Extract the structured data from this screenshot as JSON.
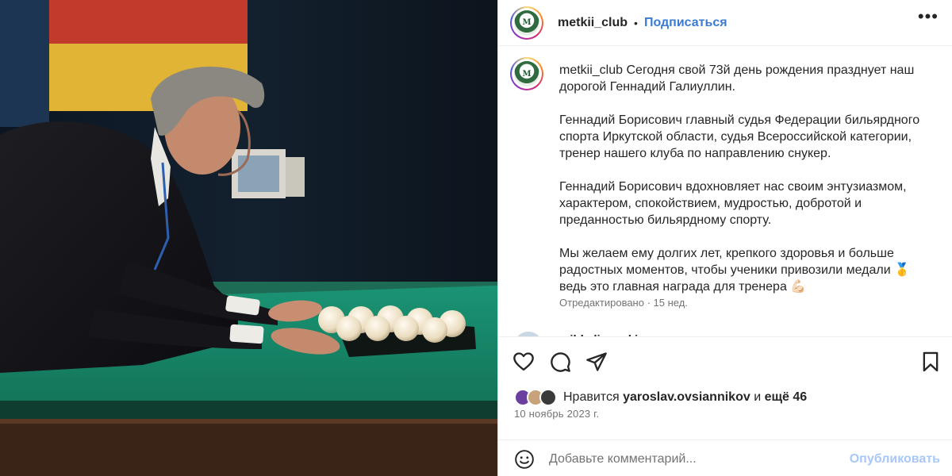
{
  "account": {
    "username": "metkii_club",
    "avatar_initials": "M",
    "follow_label": "Подписаться",
    "dot": "•",
    "more_label": "•••"
  },
  "caption": {
    "username": "metkii_club",
    "paragraphs": [
      "Сегодня свой 73й день рождения празднует наш дорогой Геннадий Галиуллин.",
      "Геннадий Борисович главный судья Федерации бильярдного спорта Иркутской области, судья Всероссийской категории, тренер нашего клуба по направлению снукер.",
      "Геннадий Борисович вдохновляет нас своим энтузиазмом, характером, спокойствием, мудростью, добротой и преданностью бильярдному спорту.",
      "Мы желаем ему долгих лет, крепкого здоровья и больше радостных моментов, чтобы ученики привозили медали 🥇 ведь это главная награда для тренера 💪🏻"
    ],
    "meta": "Отредактировано · 15 нед."
  },
  "comment_peek": {
    "text": "mihkalinovski"
  },
  "actions": {
    "like_icon": "heart-icon",
    "comment_icon": "comment-icon",
    "share_icon": "share-icon",
    "save_icon": "bookmark-icon"
  },
  "likes": {
    "prefix": "Нравится",
    "user": "yaroslav.ovsiannikov",
    "connector": "и",
    "others": "ещё 46"
  },
  "date": "10 ноябрь 2023 г.",
  "comment_box": {
    "placeholder": "Добавьте комментарий...",
    "publish_label": "Опубликовать",
    "emoji_icon": "smiley-icon"
  },
  "colors": {
    "link_blue": "#3a7bd5",
    "publish_disabled": "#a8c7fa",
    "felt_green": "#1f8a6e",
    "muted_text": "#737373"
  }
}
